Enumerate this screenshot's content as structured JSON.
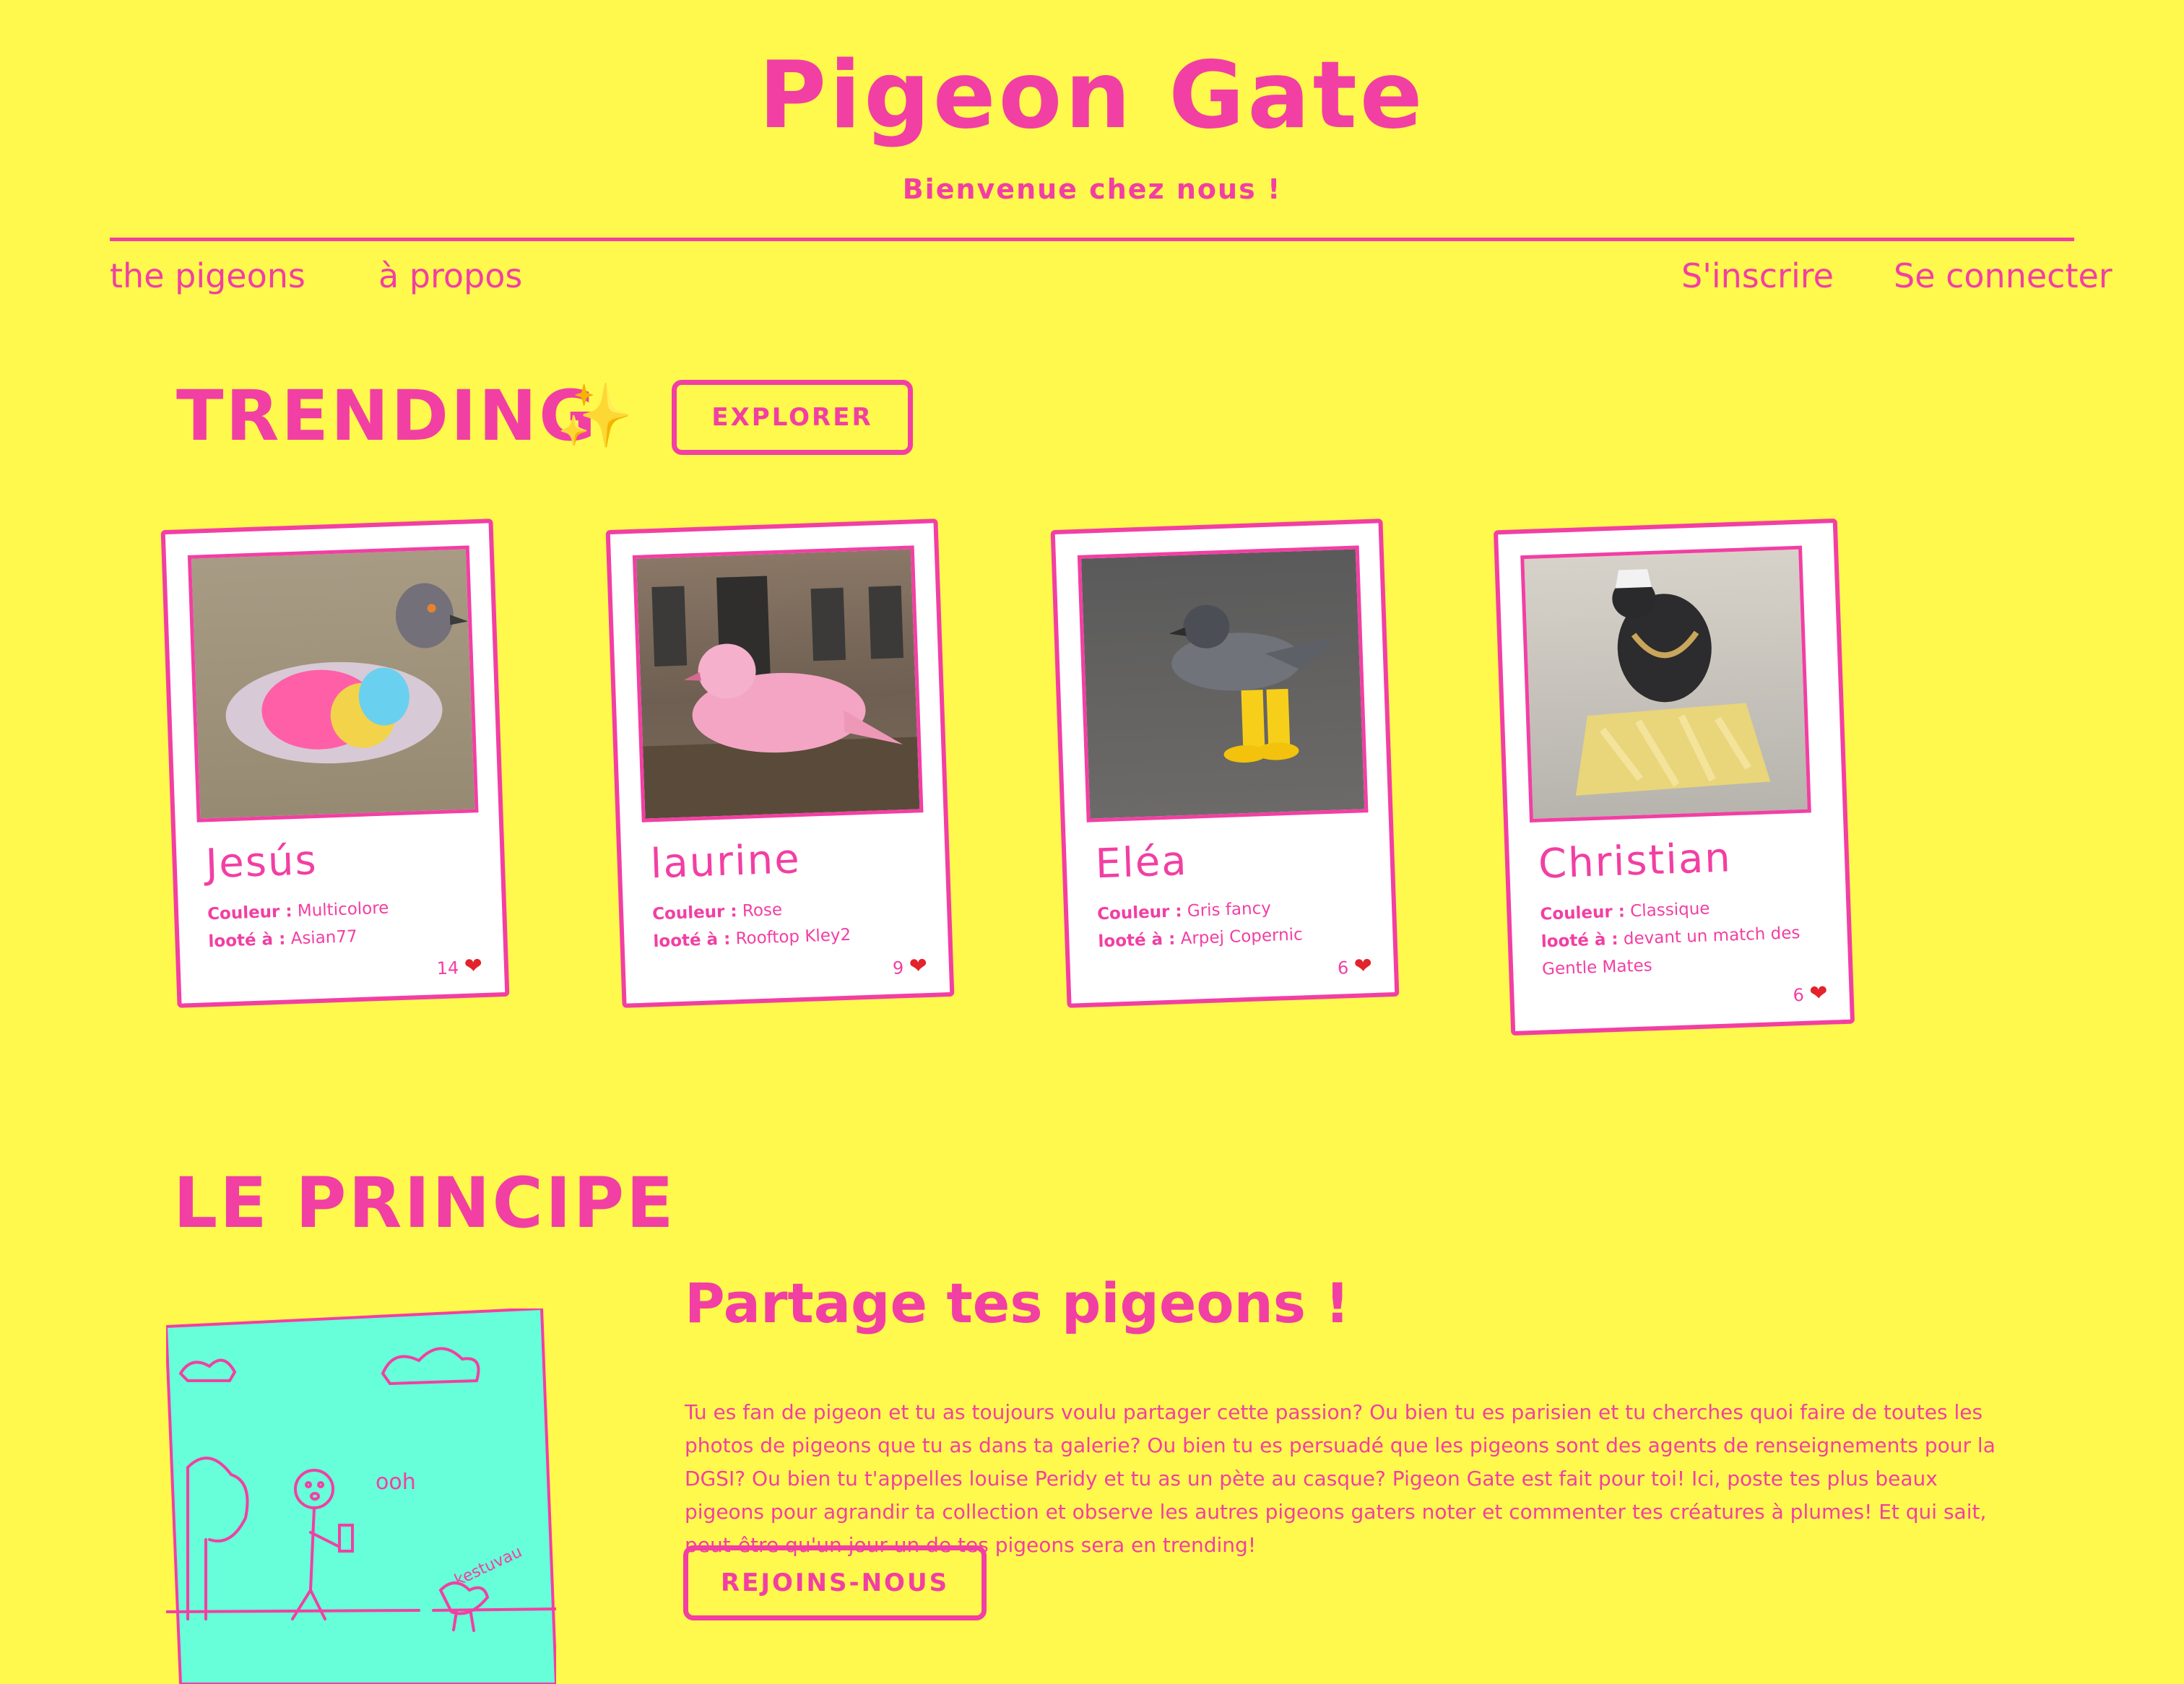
{
  "header": {
    "title": "Pigeon Gate",
    "subtitle": "Bienvenue chez nous !"
  },
  "nav": {
    "pigeons": "the pigeons",
    "about": "à propos",
    "signup": "S'inscrire",
    "login": "Se connecter"
  },
  "trending": {
    "title": "TRENDING",
    "sparkle": "✨",
    "explore_label": "EXPLORER"
  },
  "labels": {
    "color": "Couleur :",
    "looted": "looté à :"
  },
  "cards": [
    {
      "name": "Jesús",
      "color": "Multicolore",
      "looted_at": "Asian77",
      "likes": "14"
    },
    {
      "name": "laurine",
      "color": "Rose",
      "looted_at": "Rooftop Kley2",
      "likes": "9"
    },
    {
      "name": "Eléa",
      "color": "Gris fancy",
      "looted_at": "Arpej Copernic",
      "likes": "6"
    },
    {
      "name": "Christian",
      "color": "Classique",
      "looted_at": "devant un match des Gentle Mates",
      "likes": "6"
    }
  ],
  "principe": {
    "title": "LE PRINCIPE",
    "subtitle": "Partage tes pigeons !",
    "text": "Tu es fan de pigeon et tu as toujours voulu partager cette passion? Ou bien tu es parisien et tu cherches quoi faire de toutes les photos de pigeons que tu as dans ta galerie? Ou bien tu es persuadé que les pigeons sont des agents de renseignements pour la DGSI? Ou bien tu t'appelles louise Peridy et tu as un pète au casque? Pigeon Gate est fait pour toi! Ici, poste tes plus beaux pigeons pour agrandir ta collection et observe les autres pigeons gaters noter et commenter tes créatures à plumes! Et qui sait, peut-être qu'un jour un de tes pigeons sera en trending!",
    "join_label": "REJOINS-NOUS",
    "drawing_text_1": "ooh",
    "drawing_text_2": "kestuvau"
  },
  "colors": {
    "background": "#fff94e",
    "accent": "#f23fa3",
    "drawing_bg": "#66ffd9",
    "heart": "#e2232c"
  }
}
